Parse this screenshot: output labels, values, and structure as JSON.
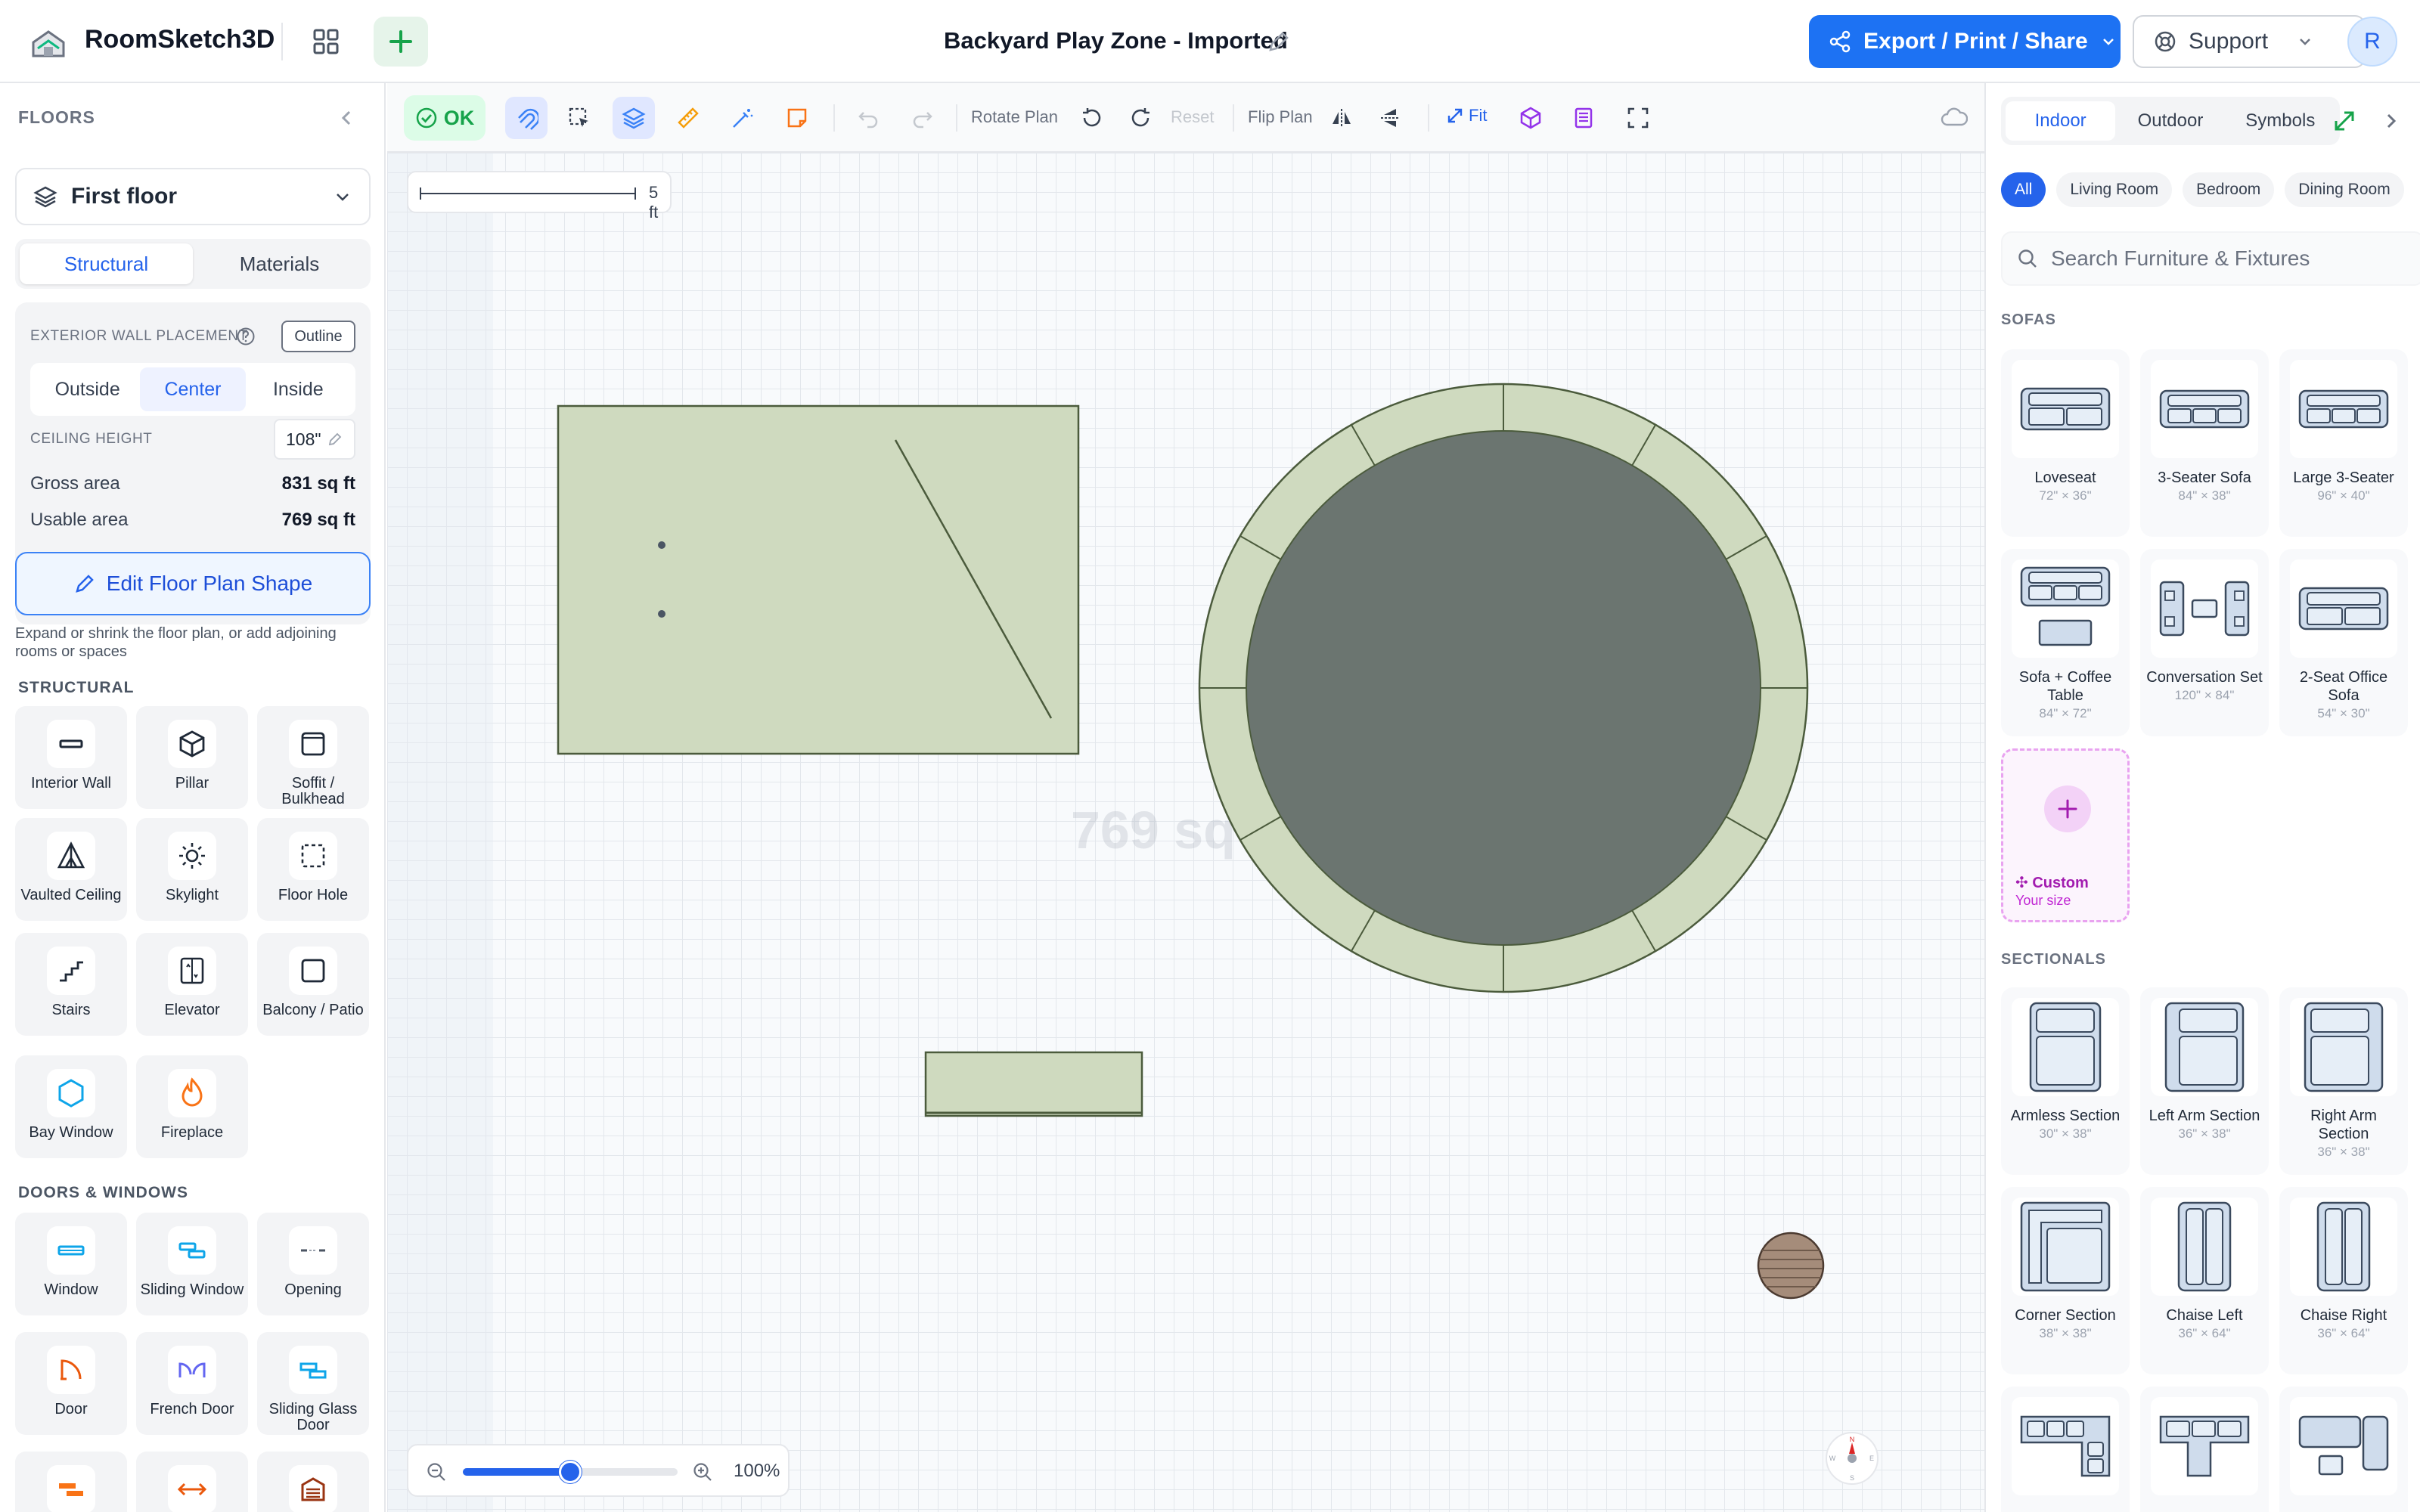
{
  "app": {
    "name": "RoomSketch3D"
  },
  "document": {
    "title": "Backyard Play Zone - Imported"
  },
  "header": {
    "export_label": "Export / Print / Share",
    "support_label": "Support",
    "avatar_initial": "R"
  },
  "floors": {
    "heading": "FLOORS",
    "selected_floor": "First floor",
    "tabs": [
      "Structural",
      "Materials"
    ],
    "exterior_wall_label": "EXTERIOR WALL PLACEMENT",
    "outline_label": "Outline",
    "placement_options": [
      "Outside",
      "Center",
      "Inside"
    ],
    "ceiling_label": "CEILING HEIGHT",
    "ceiling_value": "108\"",
    "gross_label": "Gross area",
    "gross_value": "831 sq ft",
    "usable_label": "Usable area",
    "usable_value": "769 sq ft",
    "edit_shape_label": "Edit Floor Plan Shape",
    "edit_shape_hint": "Expand or shrink the floor plan, or add adjoining rooms or spaces"
  },
  "structural": {
    "heading": "STRUCTURAL",
    "items": [
      "Interior Wall",
      "Pillar",
      "Soffit / Bulkhead",
      "Vaulted Ceiling",
      "Skylight",
      "Floor Hole",
      "Stairs",
      "Elevator",
      "Balcony / Patio",
      "Bay Window",
      "Fireplace"
    ]
  },
  "doors_windows": {
    "heading": "DOORS & WINDOWS",
    "items": [
      "Window",
      "Sliding Window",
      "Opening",
      "Door",
      "French Door",
      "Sliding Glass Door"
    ]
  },
  "toolbar": {
    "ok_label": "OK",
    "rotate_label": "Rotate Plan",
    "reset_label": "Reset",
    "flip_label": "Flip Plan",
    "fit_label": "Fit"
  },
  "canvas": {
    "scale_label": "5 ft",
    "area_watermark": "769 sq ft",
    "zoom_label": "100%",
    "zoom_level": 0.5,
    "compass": {
      "n": "N",
      "s": "S",
      "e": "E",
      "w": "W"
    }
  },
  "library": {
    "tabs": [
      "Indoor",
      "Outdoor",
      "Symbols"
    ],
    "chips": [
      "All",
      "Living Room",
      "Bedroom",
      "Dining Room"
    ],
    "search_placeholder": "Search Furniture & Fixtures",
    "sofas_heading": "SOFAS",
    "sofas": [
      {
        "name": "Loveseat",
        "size": "72\" × 36\""
      },
      {
        "name": "3-Seater Sofa",
        "size": "84\" × 38\""
      },
      {
        "name": "Large 3-Seater",
        "size": "96\" × 40\""
      },
      {
        "name": "Sofa + Coffee Table",
        "size": "84\" × 72\""
      },
      {
        "name": "Conversation Set",
        "size": "120\" × 84\""
      },
      {
        "name": "2-Seat Office Sofa",
        "size": "54\" × 30\""
      }
    ],
    "custom": {
      "name": "Custom",
      "size": "Your size"
    },
    "sectionals_heading": "SECTIONALS",
    "sectionals": [
      {
        "name": "Armless Section",
        "size": "30\" × 38\""
      },
      {
        "name": "Left Arm Section",
        "size": "36\" × 38\""
      },
      {
        "name": "Right Arm Section",
        "size": "36\" × 38\""
      },
      {
        "name": "Corner Section",
        "size": "38\" × 38\""
      },
      {
        "name": "Chaise Left",
        "size": "36\" × 64\""
      },
      {
        "name": "Chaise Right",
        "size": "36\" × 64\""
      }
    ]
  },
  "colors": {
    "accent": "#2563eb",
    "plan_fill": "#cfdabf",
    "trampoline_mat": "#6b7570",
    "ok_green": "#16a34a"
  }
}
